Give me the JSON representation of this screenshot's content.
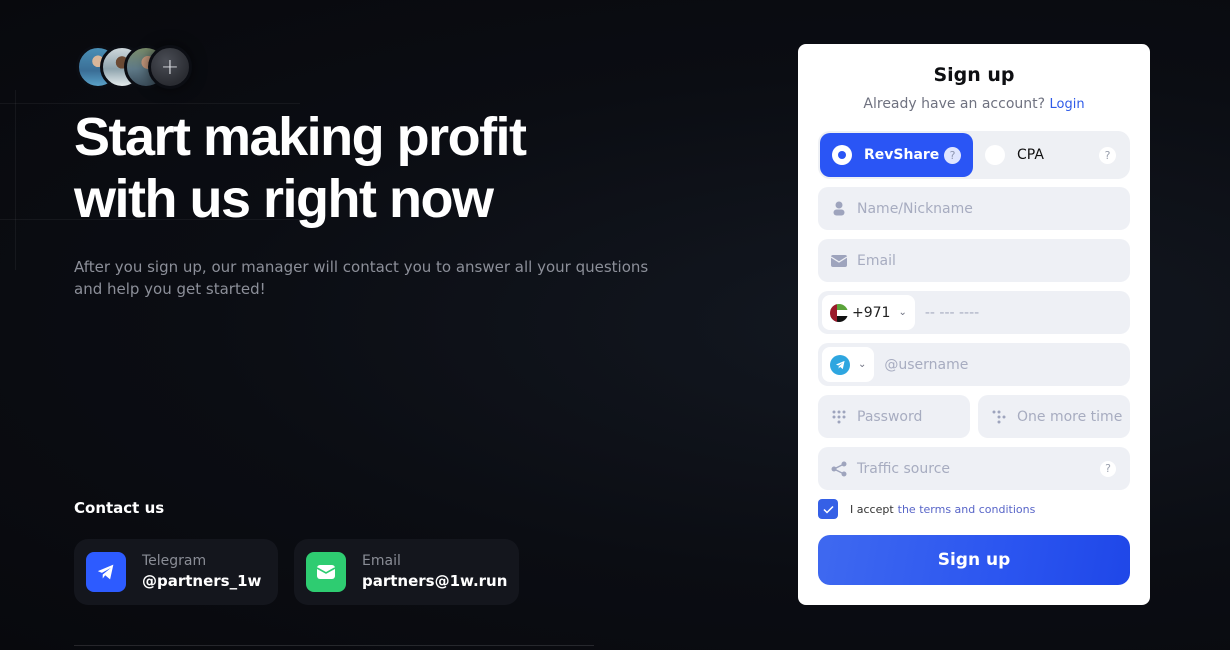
{
  "hero": {
    "avatars": [
      "avatar-1",
      "avatar-2",
      "avatar-3"
    ],
    "avatars_more_icon": "+",
    "title_line1": "Start making profit",
    "title_line2": "with us right now",
    "subtitle": "After you sign up, our manager will contact you to answer all your questions and help you get started!"
  },
  "contact": {
    "title": "Contact us",
    "items": [
      {
        "icon": "telegram-icon",
        "label": "Telegram",
        "value": "@partners_1w",
        "color": "#2d5bff"
      },
      {
        "icon": "mail-icon",
        "label": "Email",
        "value": "partners@1w.run",
        "color": "#2ecc71"
      }
    ]
  },
  "form": {
    "title": "Sign up",
    "have_account": "Already have an account?",
    "login_link": "Login",
    "plans": [
      {
        "label": "RevShare",
        "selected": true,
        "help": "?"
      },
      {
        "label": "CPA",
        "selected": false,
        "help": "?"
      }
    ],
    "fields": {
      "name_placeholder": "Name/Nickname",
      "email_placeholder": "Email",
      "phone_code": "+971",
      "phone_placeholder": "-- --- ----",
      "messenger_placeholder": "@username",
      "password_placeholder": "Password",
      "password_repeat_placeholder": "One more time",
      "traffic_placeholder": "Traffic source",
      "traffic_help": "?"
    },
    "accept_prefix": "I accept",
    "accept_link": "the terms and conditions",
    "accept_checked": true,
    "submit_label": "Sign up"
  },
  "colors": {
    "accent": "#2a55f5",
    "background": "#0b0d13",
    "card": "#ffffff",
    "link": "#2f5be8"
  }
}
